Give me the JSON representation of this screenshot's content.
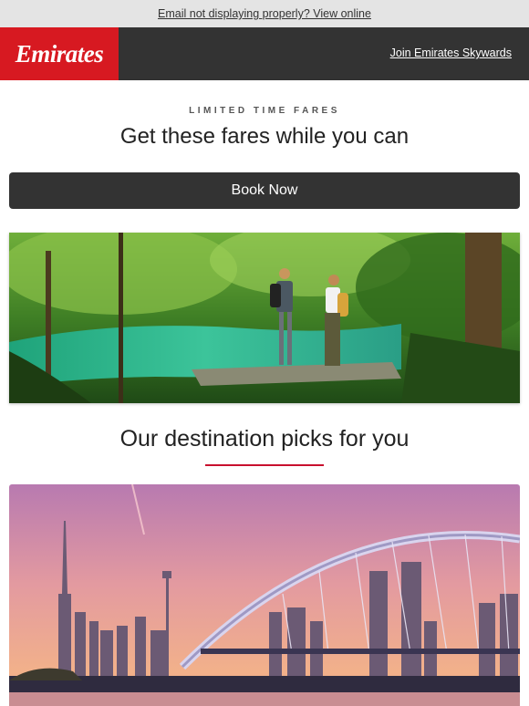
{
  "preheader": {
    "view_online": "Email not displaying properly? View online"
  },
  "header": {
    "logo_text": "Emirates",
    "skywards_link": "Join Emirates Skywards"
  },
  "promo": {
    "eyebrow": "LIMITED TIME FARES",
    "headline": "Get these fares while you can",
    "cta": "Book Now"
  },
  "destinations": {
    "title": "Our destination picks for you"
  },
  "colors": {
    "brand_red": "#d71921",
    "header_dark": "#333333",
    "accent_line": "#c8102e"
  }
}
